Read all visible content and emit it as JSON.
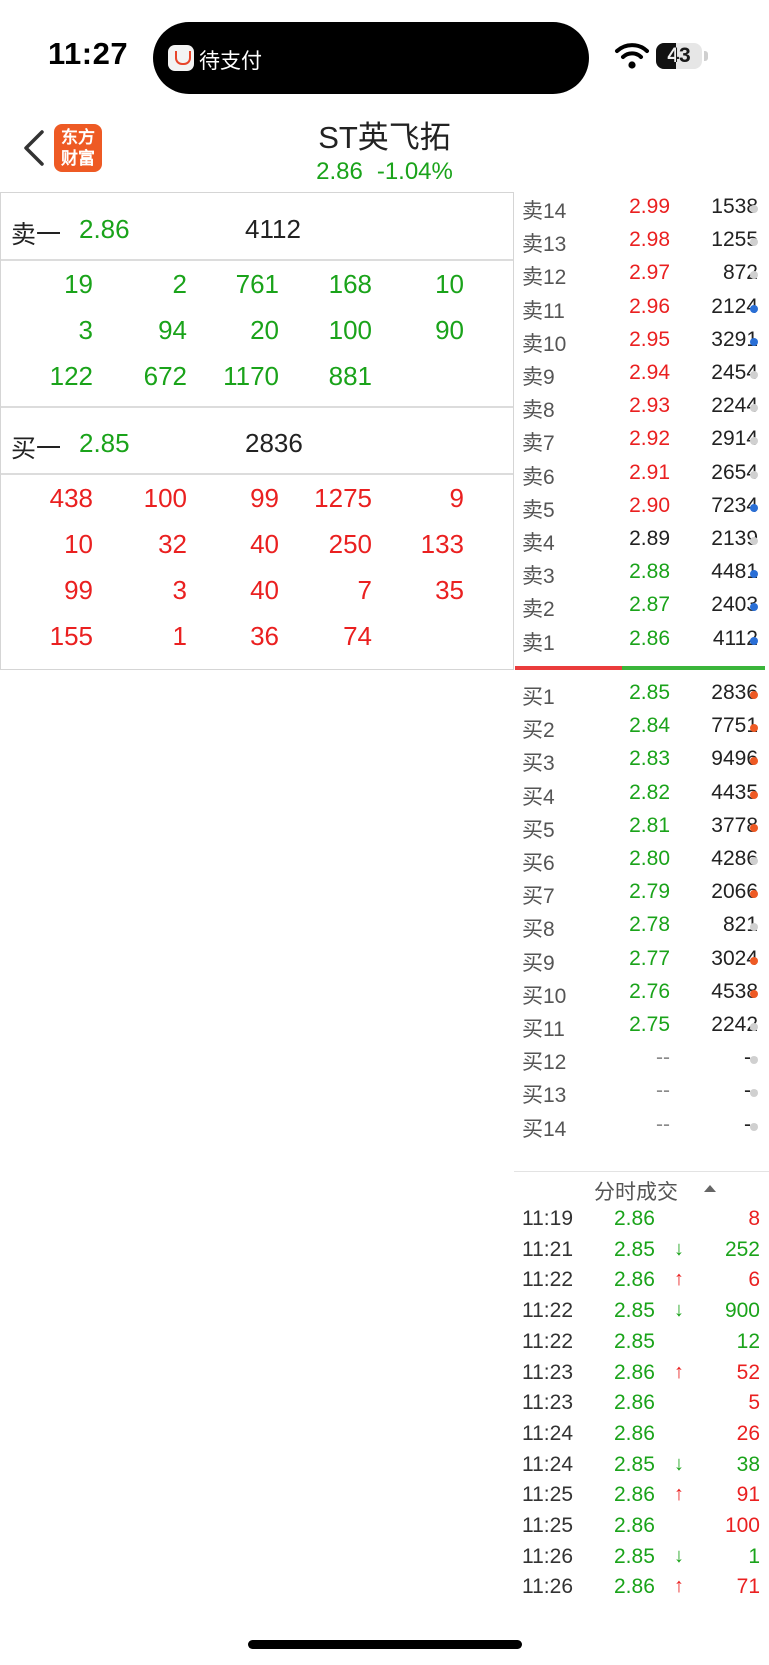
{
  "status_bar": {
    "time": "11:27",
    "island_text": "待支付",
    "battery": "43"
  },
  "header": {
    "logo_line1": "东方",
    "logo_line2": "财富",
    "title": "ST英飞拓",
    "price": "2.86",
    "change_pct": "-1.04%"
  },
  "colors": {
    "up": "#ea2020",
    "down": "#1aa31a",
    "neutral": "#222222",
    "accent": "#ee5a24",
    "dot_blue": "#2a6fd6",
    "dot_orange": "#ee5a24",
    "dot_gray": "#d0d0d0"
  },
  "queue": {
    "sell": {
      "label": "卖一",
      "price": "2.86",
      "qty": "4112",
      "rows": [
        [
          "19",
          "2",
          "761",
          "168",
          "10"
        ],
        [
          "3",
          "94",
          "20",
          "100",
          "90"
        ],
        [
          "122",
          "672",
          "1170",
          "881"
        ]
      ]
    },
    "buy": {
      "label": "买一",
      "price": "2.85",
      "qty": "2836",
      "rows": [
        [
          "438",
          "100",
          "99",
          "1275",
          "9"
        ],
        [
          "10",
          "32",
          "40",
          "250",
          "133"
        ],
        [
          "99",
          "3",
          "40",
          "7",
          "35"
        ],
        [
          "155",
          "1",
          "36",
          "74"
        ]
      ]
    }
  },
  "orderbook": {
    "asks": [
      {
        "label": "卖14",
        "price": "2.99",
        "vol": "1538",
        "color": "red",
        "dot": "gray"
      },
      {
        "label": "卖13",
        "price": "2.98",
        "vol": "1255",
        "color": "red",
        "dot": "gray"
      },
      {
        "label": "卖12",
        "price": "2.97",
        "vol": "872",
        "color": "red",
        "dot": "gray"
      },
      {
        "label": "卖11",
        "price": "2.96",
        "vol": "2124",
        "color": "red",
        "dot": "blue"
      },
      {
        "label": "卖10",
        "price": "2.95",
        "vol": "3291",
        "color": "red",
        "dot": "blue"
      },
      {
        "label": "卖9",
        "price": "2.94",
        "vol": "2454",
        "color": "red",
        "dot": "gray"
      },
      {
        "label": "卖8",
        "price": "2.93",
        "vol": "2244",
        "color": "red",
        "dot": "gray"
      },
      {
        "label": "卖7",
        "price": "2.92",
        "vol": "2914",
        "color": "red",
        "dot": "gray"
      },
      {
        "label": "卖6",
        "price": "2.91",
        "vol": "2654",
        "color": "red",
        "dot": "gray"
      },
      {
        "label": "卖5",
        "price": "2.90",
        "vol": "7234",
        "color": "red",
        "dot": "blue"
      },
      {
        "label": "卖4",
        "price": "2.89",
        "vol": "2139",
        "color": "dark",
        "dot": "gray"
      },
      {
        "label": "卖3",
        "price": "2.88",
        "vol": "4481",
        "color": "green",
        "dot": "blue"
      },
      {
        "label": "卖2",
        "price": "2.87",
        "vol": "2403",
        "color": "green",
        "dot": "blue"
      },
      {
        "label": "卖1",
        "price": "2.86",
        "vol": "4112",
        "color": "green",
        "dot": "blue"
      }
    ],
    "bids": [
      {
        "label": "买1",
        "price": "2.85",
        "vol": "2836",
        "color": "green",
        "dot": "orange"
      },
      {
        "label": "买2",
        "price": "2.84",
        "vol": "7751",
        "color": "green",
        "dot": "orange"
      },
      {
        "label": "买3",
        "price": "2.83",
        "vol": "9496",
        "color": "green",
        "dot": "orange"
      },
      {
        "label": "买4",
        "price": "2.82",
        "vol": "4435",
        "color": "green",
        "dot": "orange"
      },
      {
        "label": "买5",
        "price": "2.81",
        "vol": "3778",
        "color": "green",
        "dot": "orange"
      },
      {
        "label": "买6",
        "price": "2.80",
        "vol": "4286",
        "color": "green",
        "dot": "gray"
      },
      {
        "label": "买7",
        "price": "2.79",
        "vol": "2066",
        "color": "green",
        "dot": "orange"
      },
      {
        "label": "买8",
        "price": "2.78",
        "vol": "821",
        "color": "green",
        "dot": "gray"
      },
      {
        "label": "买9",
        "price": "2.77",
        "vol": "3024",
        "color": "green",
        "dot": "orange"
      },
      {
        "label": "买10",
        "price": "2.76",
        "vol": "4538",
        "color": "green",
        "dot": "orange"
      },
      {
        "label": "买11",
        "price": "2.75",
        "vol": "2242",
        "color": "green",
        "dot": "gray"
      },
      {
        "label": "买12",
        "price": "--",
        "vol": "--",
        "color": "dashc",
        "dot": "gray"
      },
      {
        "label": "买13",
        "price": "--",
        "vol": "--",
        "color": "dashc",
        "dot": "gray"
      },
      {
        "label": "买14",
        "price": "--",
        "vol": "--",
        "color": "dashc",
        "dot": "gray"
      }
    ]
  },
  "ticks": {
    "title": "分时成交",
    "rows": [
      {
        "time": "11:19",
        "price": "2.86",
        "dir": "",
        "vol": "8",
        "vol_color": "red"
      },
      {
        "time": "11:21",
        "price": "2.85",
        "dir": "↓",
        "vol": "252",
        "vol_color": "green"
      },
      {
        "time": "11:22",
        "price": "2.86",
        "dir": "↑",
        "vol": "6",
        "vol_color": "red"
      },
      {
        "time": "11:22",
        "price": "2.85",
        "dir": "↓",
        "vol": "900",
        "vol_color": "green"
      },
      {
        "time": "11:22",
        "price": "2.85",
        "dir": "",
        "vol": "12",
        "vol_color": "green"
      },
      {
        "time": "11:23",
        "price": "2.86",
        "dir": "↑",
        "vol": "52",
        "vol_color": "red"
      },
      {
        "time": "11:23",
        "price": "2.86",
        "dir": "",
        "vol": "5",
        "vol_color": "red"
      },
      {
        "time": "11:24",
        "price": "2.86",
        "dir": "",
        "vol": "26",
        "vol_color": "red"
      },
      {
        "time": "11:24",
        "price": "2.85",
        "dir": "↓",
        "vol": "38",
        "vol_color": "green"
      },
      {
        "time": "11:25",
        "price": "2.86",
        "dir": "↑",
        "vol": "91",
        "vol_color": "red"
      },
      {
        "time": "11:25",
        "price": "2.86",
        "dir": "",
        "vol": "100",
        "vol_color": "red"
      },
      {
        "time": "11:26",
        "price": "2.85",
        "dir": "↓",
        "vol": "1",
        "vol_color": "green"
      },
      {
        "time": "11:26",
        "price": "2.86",
        "dir": "↑",
        "vol": "71",
        "vol_color": "red"
      }
    ]
  }
}
